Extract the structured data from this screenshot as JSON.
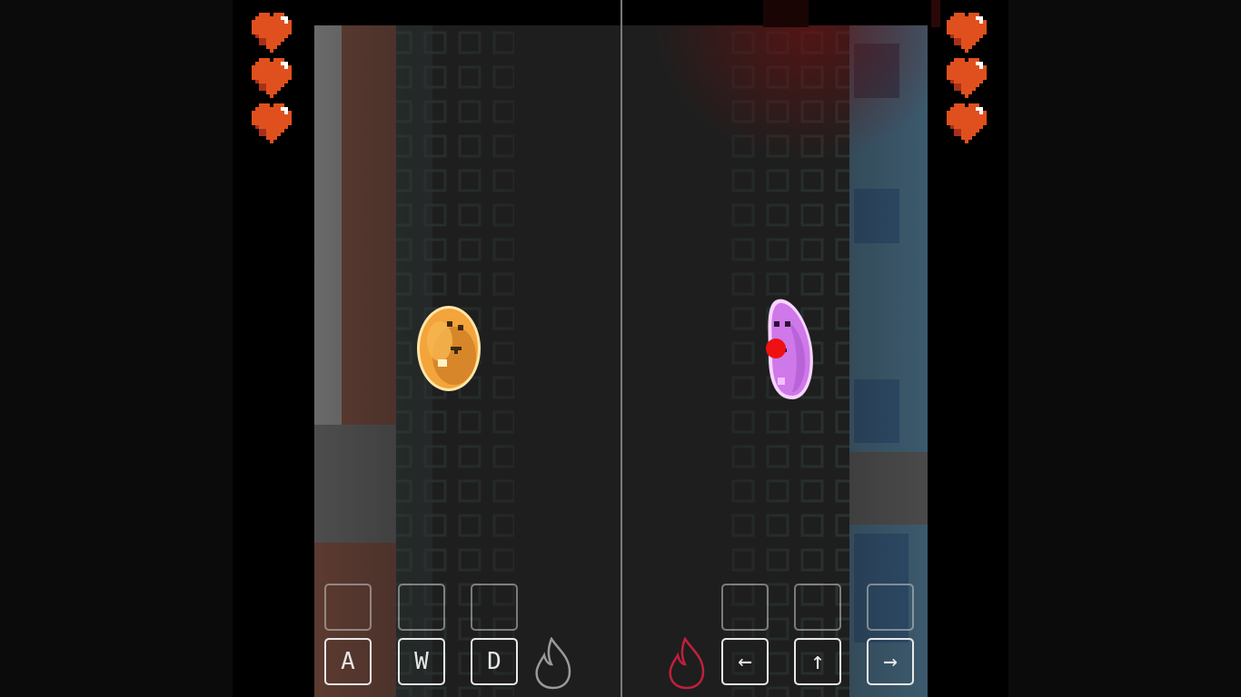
{
  "player1": {
    "hearts": 3,
    "keys": [
      {
        "label": "A",
        "action": "left"
      },
      {
        "label": "W",
        "action": "jump"
      },
      {
        "label": "D",
        "action": "right"
      }
    ],
    "flame_icon": "flame-outline-gray",
    "character": "potato-orange"
  },
  "player2": {
    "hearts": 3,
    "keys": [
      {
        "label": "←",
        "action": "left"
      },
      {
        "label": "↑",
        "action": "jump"
      },
      {
        "label": "→",
        "action": "right"
      }
    ],
    "flame_icon": "flame-outline-red",
    "character": "purple-bean"
  },
  "colors": {
    "heart": "#e0501e",
    "potato": "#f0a030",
    "bean": "#d67cf0",
    "flame_p1": "#9a9a9a",
    "flame_p2": "#c0203c",
    "arena": "#1e1e1e"
  }
}
